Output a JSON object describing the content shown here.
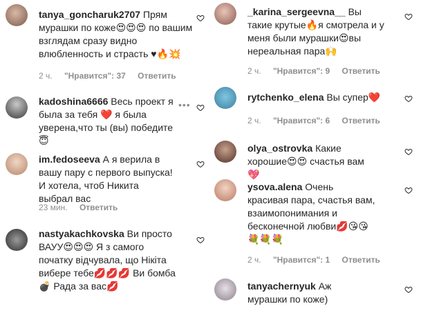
{
  "left": [
    {
      "username": "tanya_goncharuk2707",
      "text": "Прям мурашки по коже😍😍😍 по вашим взглядам сразу видно влюбленность и страсть ♥🔥💥",
      "time": "2 ч.",
      "likes": "\"Нравится\": 37",
      "reply": "Ответить"
    },
    {
      "username": "kadoshina6666",
      "text": "Весь проект я была за тебя ❤️ я была уверена,что ты (вы) победите 😇",
      "time": "",
      "likes": "",
      "reply": ""
    },
    {
      "username": "im.fedoseeva",
      "text": "А я верила в вашу пару с первого выпуска! И хотела, чтоб Никита выбрал вас",
      "time": "23 мин.",
      "likes": "",
      "reply": "Ответить"
    },
    {
      "username": "nastyakachkovska",
      "text": "Ви просто ВАУУ😍😍😍 Я з самого початку відчувала, що Нікіта вибере тебе💋💋💋 Ви бомба💣 Рада за вас💋",
      "time": "",
      "likes": "",
      "reply": ""
    }
  ],
  "right": [
    {
      "username": "_karina_sergeevna__",
      "text": "Вы такие крутые🔥я смотрела и у меня были мурашки😍вы нереальная пара🙌",
      "time": "2 ч.",
      "likes": "\"Нравится\": 9",
      "reply": "Ответить"
    },
    {
      "username": "rytchenko_elena",
      "text": "Вы супер❤️",
      "time": "2 ч.",
      "likes": "\"Нравится\": 6",
      "reply": "Ответить"
    },
    {
      "username": "olya_ostrovka",
      "text": "Какие хорошие😍😍 счастья вам 💖",
      "time": "",
      "likes": "",
      "reply": ""
    },
    {
      "username": "ysova.alena",
      "text": "Очень красивая пара, счастья вам, взаимопонимания и бесконечной любви💋😘😘💐💐💐",
      "time": "2 ч.",
      "likes": "\"Нравится\": 1",
      "reply": "Ответить"
    },
    {
      "username": "tanyachernyuk",
      "text": "Аж мурашки по коже)",
      "time": "",
      "likes": "",
      "reply": ""
    }
  ],
  "colors": {
    "text": "#262626",
    "meta": "#8e8e8e",
    "heart_red": "#ed4956"
  }
}
